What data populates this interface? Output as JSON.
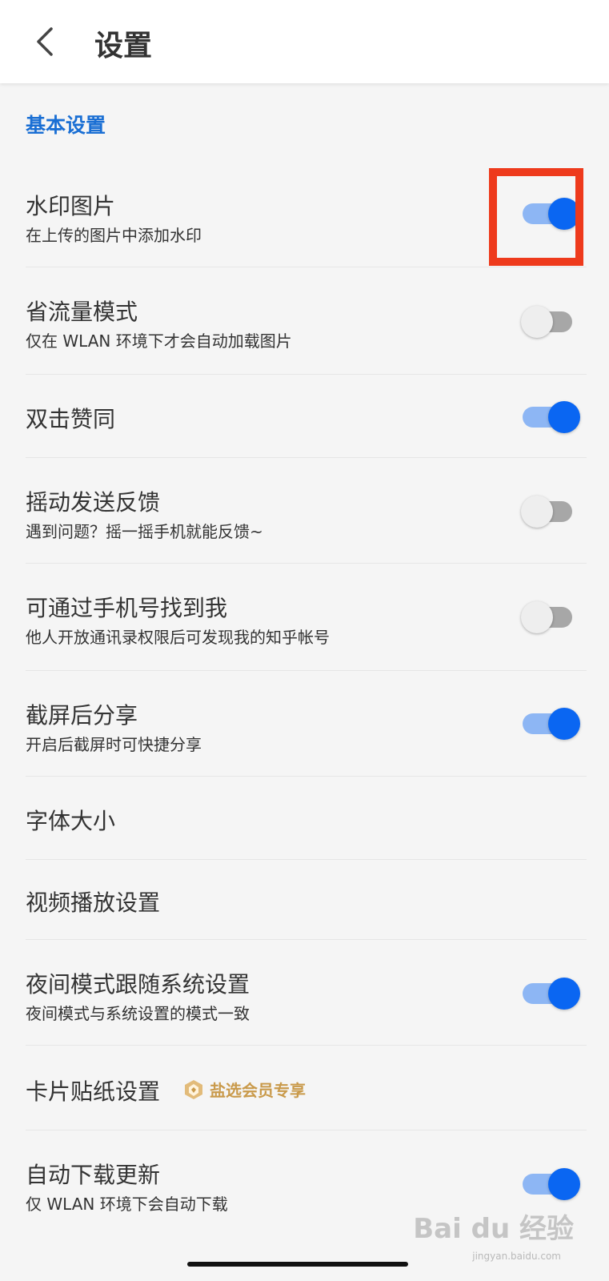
{
  "header": {
    "title": "设置",
    "back_icon": "chevron-left-icon"
  },
  "section": {
    "title": "基本设置"
  },
  "colors": {
    "accent": "#0a66f2",
    "section": "#1a6fd4",
    "highlight": "#ee3a1c",
    "badge": "#c99a4b"
  },
  "settings": [
    {
      "title": "水印图片",
      "subtitle": "在上传的图片中添加水印",
      "toggle": "on"
    },
    {
      "title": "省流量模式",
      "subtitle": "仅在 WLAN 环境下才会自动加载图片",
      "toggle": "off"
    },
    {
      "title": "双击赞同",
      "toggle": "on"
    },
    {
      "title": "摇动发送反馈",
      "subtitle": "遇到问题？摇一摇手机就能反馈~",
      "toggle": "off"
    },
    {
      "title": "可通过手机号找到我",
      "subtitle": "他人开放通讯录权限后可发现我的知乎帐号",
      "toggle": "off"
    },
    {
      "title": "截屏后分享",
      "subtitle": "开启后截屏时可快捷分享",
      "toggle": "on"
    },
    {
      "title": "字体大小"
    },
    {
      "title": "视频播放设置"
    },
    {
      "title": "夜间模式跟随系统设置",
      "subtitle": "夜间模式与系统设置的模式一致",
      "toggle": "on"
    },
    {
      "title": "卡片贴纸设置",
      "badge": "盐选会员专享",
      "badge_icon": "vip-icon"
    },
    {
      "title": "自动下载更新",
      "subtitle": "仅 WLAN 环境下会自动下载",
      "toggle": "on"
    }
  ],
  "watermark": {
    "text": "Bai du 经验",
    "sub": "jingyan.baidu.com"
  }
}
